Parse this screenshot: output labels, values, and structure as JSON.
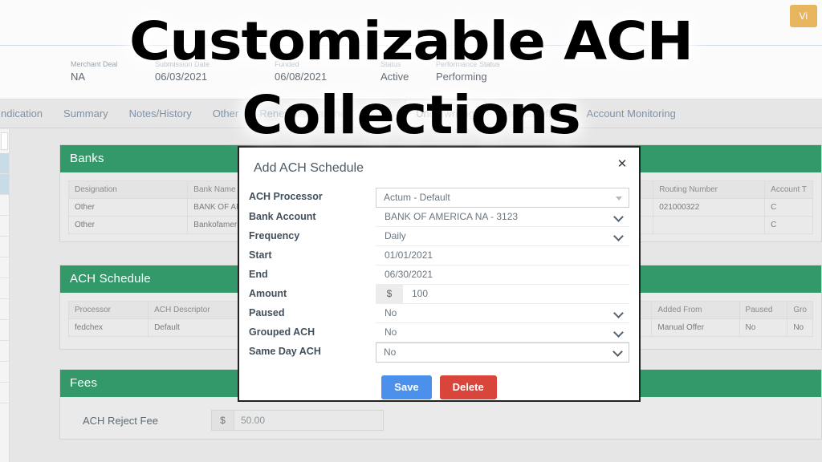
{
  "overlay": {
    "title": "Customizable ACH Collections"
  },
  "header": {
    "view_button": "Vi",
    "meta": [
      {
        "label": "Merchant Deal",
        "value": "NA"
      },
      {
        "label": "Submission Date",
        "value": "06/03/2021"
      },
      {
        "label": "Funded",
        "value": "06/08/2021"
      },
      {
        "label": "Status",
        "value": "Active"
      },
      {
        "label": "Performance Status",
        "value": "Performing"
      }
    ]
  },
  "tabs": [
    {
      "label": "ndication",
      "active": false
    },
    {
      "label": "Summary",
      "active": false
    },
    {
      "label": "Notes/History",
      "active": false
    },
    {
      "label": "Other",
      "active": false
    },
    {
      "label": "Renewals/Tranches",
      "active": false
    },
    {
      "label": "Files",
      "active": false
    },
    {
      "label": "Underwriting",
      "active": true
    },
    {
      "label": "External Offers",
      "active": false
    },
    {
      "label": "Account Monitoring",
      "active": false
    }
  ],
  "banks_card": {
    "title": "Banks",
    "columns": [
      "Designation",
      "Bank Name",
      "Routing Number",
      "Account T"
    ],
    "rows": [
      {
        "designation": "Other",
        "bank_name": "BANK OF AMERIC",
        "routing": "021000322",
        "account_type": "C"
      },
      {
        "designation": "Other",
        "bank_name": "Bankofamerica",
        "routing": "",
        "account_type": "C"
      }
    ]
  },
  "ach_schedule_card": {
    "title": "ACH Schedule",
    "columns": [
      "Processor",
      "ACH Descriptor",
      "Added From",
      "Paused",
      "Gro"
    ],
    "rows": [
      {
        "processor": "fedchex",
        "descriptor": "Default",
        "added_from": "Manual Offer",
        "paused": "No",
        "grouped": "No"
      }
    ]
  },
  "fees_card": {
    "title": "Fees",
    "ach_reject_fee_label": "ACH Reject Fee",
    "ach_reject_fee_currency": "$",
    "ach_reject_fee_value": "50.00"
  },
  "modal": {
    "title": "Add ACH Schedule",
    "close_label": "✕",
    "fields": [
      {
        "label": "ACH Processor",
        "value": "Actum - Default",
        "type": "select-box"
      },
      {
        "label": "Bank Account",
        "value": "BANK OF AMERICA NA - 3123",
        "type": "select-line"
      },
      {
        "label": "Frequency",
        "value": "Daily",
        "type": "select-line"
      },
      {
        "label": "Start",
        "value": "01/01/2021",
        "type": "text"
      },
      {
        "label": "End",
        "value": "06/30/2021",
        "type": "text"
      },
      {
        "label": "Amount",
        "value": "100",
        "type": "currency",
        "adornment": "$"
      },
      {
        "label": "Paused",
        "value": "No",
        "type": "select-line"
      },
      {
        "label": "Grouped ACH",
        "value": "No",
        "type": "select-line"
      },
      {
        "label": "Same Day ACH",
        "value": "No",
        "type": "select-line"
      }
    ],
    "save_label": "Save",
    "delete_label": "Delete"
  },
  "colors": {
    "card_header_green": "#33996b",
    "save_blue": "#4b91ec",
    "delete_red": "#d9453a",
    "view_amber": "#e7b55e",
    "page_bg": "#e6e6e6"
  }
}
